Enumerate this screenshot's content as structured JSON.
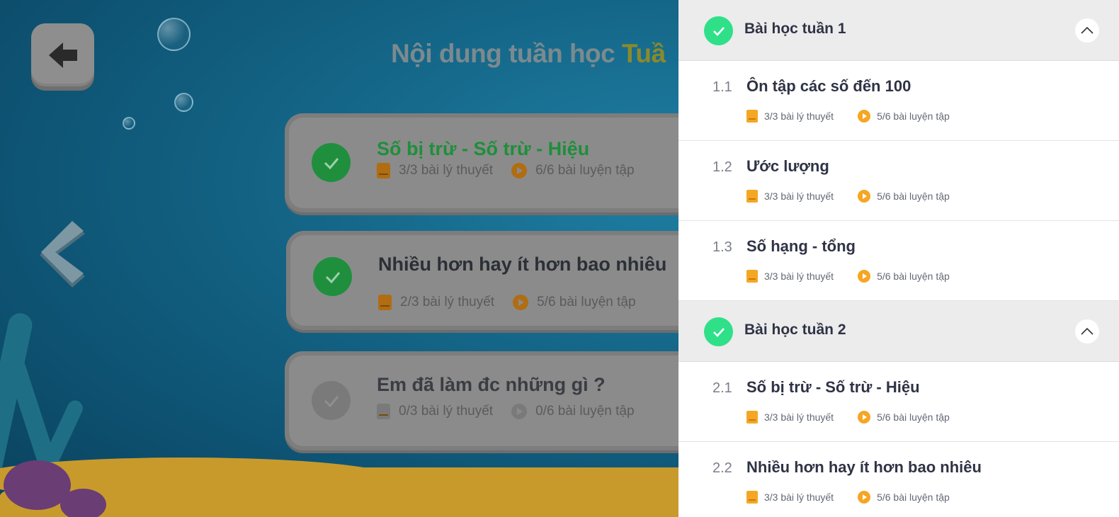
{
  "page": {
    "title_main": "Nội dung tuần học",
    "title_highlight": "Tuầ"
  },
  "lesson_cards": [
    {
      "title": "Số bị trừ - Số trừ - Hiệu",
      "theory": "3/3 bài lý thuyết",
      "practice": "6/6 bài luyện tập",
      "completed": true,
      "title_color": "#1e8f3a"
    },
    {
      "title": "Nhiều hơn hay ít hơn bao nhiêu",
      "theory": "2/3 bài lý thuyết",
      "practice": "5/6 bài luyện tập",
      "completed": true,
      "title_color": "#2b2f36"
    },
    {
      "title": "Em đã làm đc những gì ?",
      "theory": "0/3 bài lý thuyết",
      "practice": "0/6 bài luyện tập",
      "completed": false,
      "title_color": "#3a3d42"
    }
  ],
  "panel": {
    "weeks": [
      {
        "title": "Bài học tuần 1",
        "lessons": [
          {
            "num": "1.1",
            "title": "Ôn tập các số đến 100",
            "theory": "3/3 bài lý thuyết",
            "practice": "5/6 bài luyện tập"
          },
          {
            "num": "1.2",
            "title": "Ước lượng",
            "theory": "3/3 bài lý thuyết",
            "practice": "5/6 bài luyện tập"
          },
          {
            "num": "1.3",
            "title": "Số hạng - tổng",
            "theory": "3/3 bài lý thuyết",
            "practice": "5/6 bài luyện tập"
          }
        ]
      },
      {
        "title": "Bài học tuần 2",
        "lessons": [
          {
            "num": "2.1",
            "title": "Số bị trừ - Số trừ - Hiệu",
            "theory": "3/3 bài lý thuyết",
            "practice": "5/6 bài luyện tập"
          },
          {
            "num": "2.2",
            "title": "Nhiều hơn hay ít hơn bao nhiêu",
            "theory": "3/3 bài lý thuyết",
            "practice": "5/6 bài luyện tập"
          }
        ]
      }
    ]
  },
  "colors": {
    "done_check": "#2fe089",
    "card_check_done": "#1f8f3e",
    "card_check_todo": "#7a7a7a",
    "accent_orange": "#f5a623"
  }
}
